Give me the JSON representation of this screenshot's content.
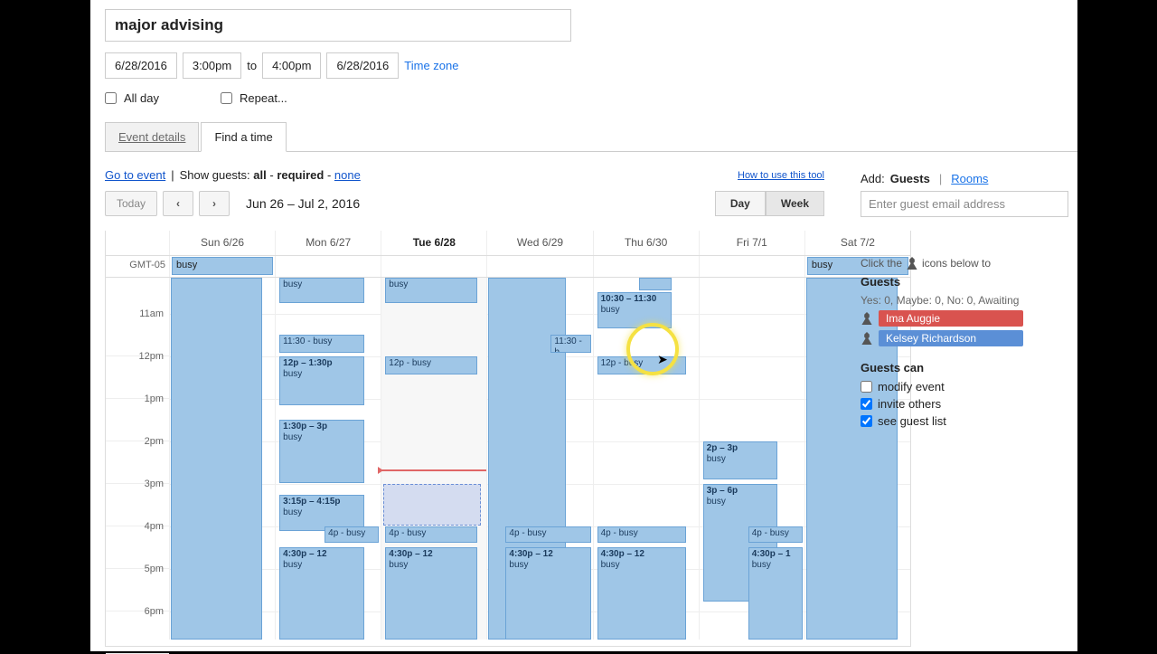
{
  "event": {
    "title": "major advising",
    "start_date": "6/28/2016",
    "start_time": "3:00pm",
    "to": "to",
    "end_time": "4:00pm",
    "end_date": "6/28/2016",
    "timezone_link": "Time zone",
    "all_day": "All day",
    "repeat": "Repeat..."
  },
  "tabs": {
    "details": "Event details",
    "find": "Find a time"
  },
  "find_bar": {
    "go_to_event": "Go to event",
    "show_guests": "Show guests:",
    "all": "all",
    "required": "required",
    "none": "none",
    "how_to": "How to use this tool"
  },
  "toolbar": {
    "today": "Today",
    "range": "Jun 26 – Jul 2, 2016",
    "day": "Day",
    "week": "Week"
  },
  "tz": "GMT-05",
  "days": [
    "Sun 6/26",
    "Mon 6/27",
    "Tue 6/28",
    "Wed 6/29",
    "Thu 6/30",
    "Fri 7/1",
    "Sat 7/2"
  ],
  "hours": [
    "11am",
    "12pm",
    "1pm",
    "2pm",
    "3pm",
    "4pm",
    "5pm",
    "6pm"
  ],
  "allday": {
    "sun": "busy",
    "sat": "busy"
  },
  "events": {
    "mon": {
      "top": "busy",
      "e1130": "11:30 - busy",
      "e12": {
        "t": "12p – 1:30p",
        "b": "busy"
      },
      "e130": {
        "t": "1:30p – 3p",
        "b": "busy"
      },
      "e315": {
        "t": "3:15p – 4:15p",
        "b": "busy"
      },
      "e4p": "4p - busy",
      "e430": {
        "t": "4:30p – 12",
        "b": "busy"
      }
    },
    "tue": {
      "top": "busy",
      "e12": "12p - busy",
      "e4p": "4p - busy",
      "e430": {
        "t": "4:30p – 12",
        "b": "busy"
      }
    },
    "wed": {
      "e1130": "11:30 - b",
      "e4p": "4p - busy",
      "e430": {
        "t": "4:30p – 12",
        "b": "busy"
      }
    },
    "thu": {
      "e1030": {
        "t": "10:30 – 11:30",
        "b": "busy"
      },
      "e12": "12p - busy",
      "e4p": "4p - busy",
      "e430": {
        "t": "4:30p – 12",
        "b": "busy"
      }
    },
    "fri": {
      "e2p": {
        "t": "2p – 3p",
        "b": "busy"
      },
      "e3p": {
        "t": "3p – 6p",
        "b": "busy"
      },
      "e4p": "4p - busy",
      "e430": {
        "t": "4:30p – 1",
        "b": "busy"
      }
    }
  },
  "side": {
    "add": "Add:",
    "guests": "Guests",
    "rooms": "Rooms",
    "placeholder": "Enter guest email address",
    "hint_pre": "Click the",
    "hint_post": "icons below to",
    "guests_label": "Guests",
    "rsvp": "Yes: 0, Maybe: 0, No: 0, Awaiting",
    "g1": "Ima Auggie",
    "g2": "Kelsey Richardson",
    "can": "Guests can",
    "modify": "modify event",
    "invite": "invite others",
    "see": "see guest list"
  }
}
